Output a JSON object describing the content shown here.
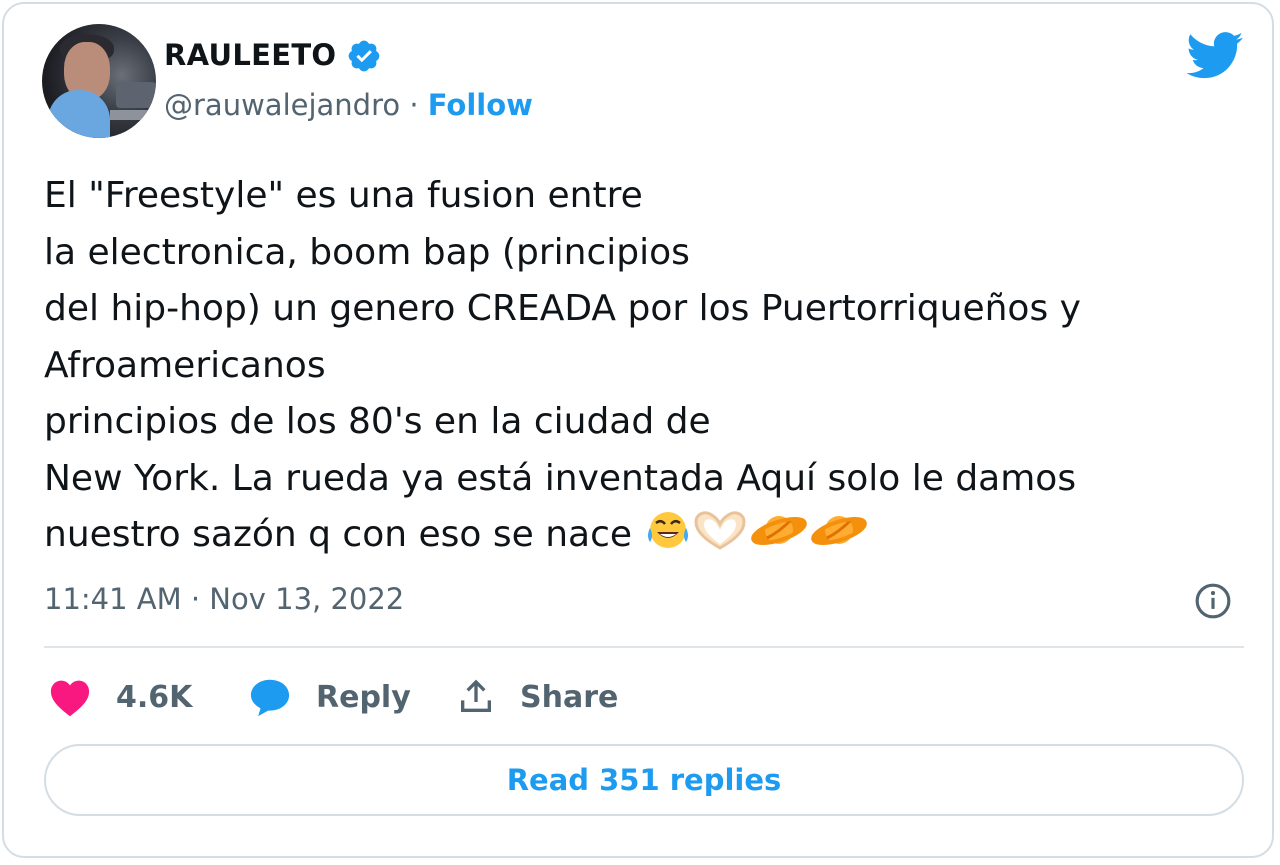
{
  "author": {
    "name": "RAULEETO",
    "handle": "@rauwalejandro",
    "separator": "·",
    "follow_label": "Follow"
  },
  "tweet": {
    "lines": [
      "El \"Freestyle\" es una fusion entre",
      "la electronica, boom bap (principios",
      "del hip-hop) un genero CREADA por los Puertorriqueños y",
      "Afroamericanos",
      "principios de los 80's en la ciudad de",
      "New York. La rueda ya está inventada Aquí solo le damos",
      "nuestro sazón q con eso se nace"
    ],
    "emojis": [
      "😂",
      "🫶",
      "🪐",
      "🪐"
    ],
    "timestamp": "11:41 AM · Nov 13, 2022"
  },
  "actions": {
    "like_count": "4.6K",
    "reply_label": "Reply",
    "share_label": "Share"
  },
  "read_replies_label": "Read 351 replies",
  "colors": {
    "accent": "#1d9bf0",
    "like": "#f91880",
    "muted": "#536471",
    "border": "#d4dde3"
  }
}
